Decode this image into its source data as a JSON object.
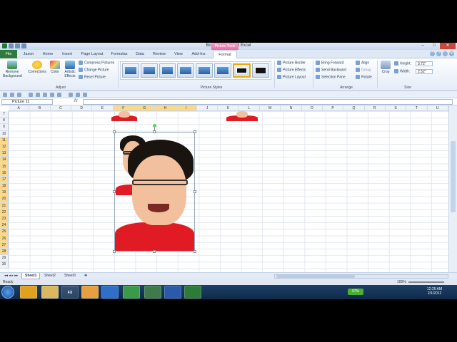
{
  "window": {
    "title": "Book2 - Microsoft Excel",
    "context_tab": "Picture Tools"
  },
  "tabs": [
    "File",
    "Jason",
    "Home",
    "Insert",
    "Page Layout",
    "Formulas",
    "Data",
    "Review",
    "View",
    "Add-Ins",
    "Format"
  ],
  "ribbon": {
    "adjust": {
      "remove_bg": "Remove Background",
      "corrections": "Corrections",
      "color": "Color",
      "artistic": "Artistic Effects",
      "compress": "Compress Pictures",
      "change": "Change Picture",
      "reset": "Reset Picture",
      "label": "Adjust"
    },
    "styles_label": "Picture Styles",
    "picture": {
      "border": "Picture Border",
      "effects": "Picture Effects",
      "layout": "Picture Layout"
    },
    "arrange": {
      "forward": "Bring Forward",
      "backward": "Send Backward",
      "pane": "Selection Pane",
      "align": "Align",
      "group": "Group",
      "rotate": "Rotate",
      "label": "Arrange"
    },
    "size": {
      "crop": "Crop",
      "height_label": "Height:",
      "height": "3.72\"",
      "width_label": "Width:",
      "width": "2.52\"",
      "label": "Size"
    }
  },
  "formula_bar": {
    "name_box": "Picture 11",
    "fx": "fx"
  },
  "columns": [
    "A",
    "B",
    "C",
    "D",
    "E",
    "F",
    "G",
    "H",
    "I",
    "J",
    "K",
    "L",
    "M",
    "N",
    "O",
    "P",
    "Q",
    "R",
    "S",
    "T",
    "U"
  ],
  "rows": [
    "7",
    "8",
    "9",
    "10",
    "11",
    "12",
    "13",
    "14",
    "15",
    "16",
    "17",
    "18",
    "19",
    "20",
    "21",
    "22",
    "23",
    "24",
    "25",
    "26",
    "27",
    "28",
    "29",
    "30"
  ],
  "sheets": [
    "Sheet1",
    "Sheet2",
    "Sheet3"
  ],
  "status": {
    "ready": "Ready",
    "zoom": "100%"
  },
  "taskbar": {
    "battery": "97%",
    "time": "12:29 AM",
    "date": "2/1/2012",
    "fx_label": "FX"
  }
}
